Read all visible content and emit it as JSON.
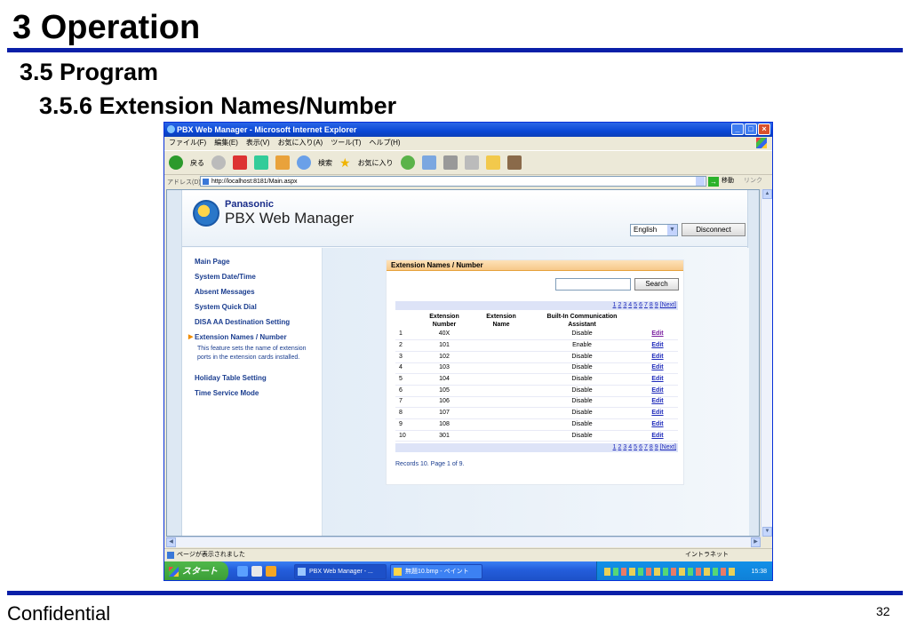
{
  "slide": {
    "title": "3 Operation",
    "section": "3.5 Program",
    "subsection": "3.5.6 Extension Names/Number",
    "footer": "Confidential",
    "page_number": "32"
  },
  "browser": {
    "window_title": "PBX Web Manager - Microsoft Internet Explorer",
    "menu": [
      "ファイル(F)",
      "編集(E)",
      "表示(V)",
      "お気に入り(A)",
      "ツール(T)",
      "ヘルプ(H)"
    ],
    "toolbar": {
      "back": "戻る",
      "search": "検索",
      "favorites": "お気に入り"
    },
    "address_label": "アドレス(D)",
    "address": "http://localhost:8181/Main.aspx",
    "go_label": "移動",
    "links_label": "リンク",
    "status_text": "ページが表示されました",
    "zone_text": "イントラネット",
    "start_label": "スタート",
    "tasks": [
      "PBX Web Manager - ...",
      "無題10.bmp - ペイント"
    ],
    "clock": "15:38",
    "accent": "#0a47d6"
  },
  "app": {
    "brand": "Panasonic",
    "product": "PBX Web Manager",
    "language": "English",
    "disconnect_label": "Disconnect"
  },
  "menu": {
    "items": [
      "Main Page",
      "System Date/Time",
      "Absent Messages",
      "System Quick Dial",
      "DISA AA Destination Setting",
      "Extension Names / Number",
      "Holiday Table Setting",
      "Time Service Mode"
    ],
    "active_index": 5,
    "description": "This feature sets the name of extension ports in the extension cards installed."
  },
  "panel": {
    "title": "Extension Names / Number",
    "search_value": "",
    "search_label": "Search",
    "pager": [
      "1",
      "2",
      "3",
      "4",
      "5",
      "6",
      "7",
      "8",
      "9",
      "[Next]"
    ],
    "columns": {
      "number": [
        "Extension",
        "Number"
      ],
      "name": [
        "Extension",
        "Name"
      ],
      "bic": [
        "Built-In Communication",
        "Assistant"
      ]
    },
    "rows": [
      {
        "idx": "1",
        "number": "40X",
        "name": "",
        "bic": "Disable",
        "edit": "Edit"
      },
      {
        "idx": "2",
        "number": "101",
        "name": "",
        "bic": "Enable",
        "edit": "Edit"
      },
      {
        "idx": "3",
        "number": "102",
        "name": "",
        "bic": "Disable",
        "edit": "Edit"
      },
      {
        "idx": "4",
        "number": "103",
        "name": "",
        "bic": "Disable",
        "edit": "Edit"
      },
      {
        "idx": "5",
        "number": "104",
        "name": "",
        "bic": "Disable",
        "edit": "Edit"
      },
      {
        "idx": "6",
        "number": "105",
        "name": "",
        "bic": "Disable",
        "edit": "Edit"
      },
      {
        "idx": "7",
        "number": "106",
        "name": "",
        "bic": "Disable",
        "edit": "Edit"
      },
      {
        "idx": "8",
        "number": "107",
        "name": "",
        "bic": "Disable",
        "edit": "Edit"
      },
      {
        "idx": "9",
        "number": "108",
        "name": "",
        "bic": "Disable",
        "edit": "Edit"
      },
      {
        "idx": "10",
        "number": "301",
        "name": "",
        "bic": "Disable",
        "edit": "Edit"
      }
    ],
    "records": "Records 10. Page 1 of 9."
  }
}
